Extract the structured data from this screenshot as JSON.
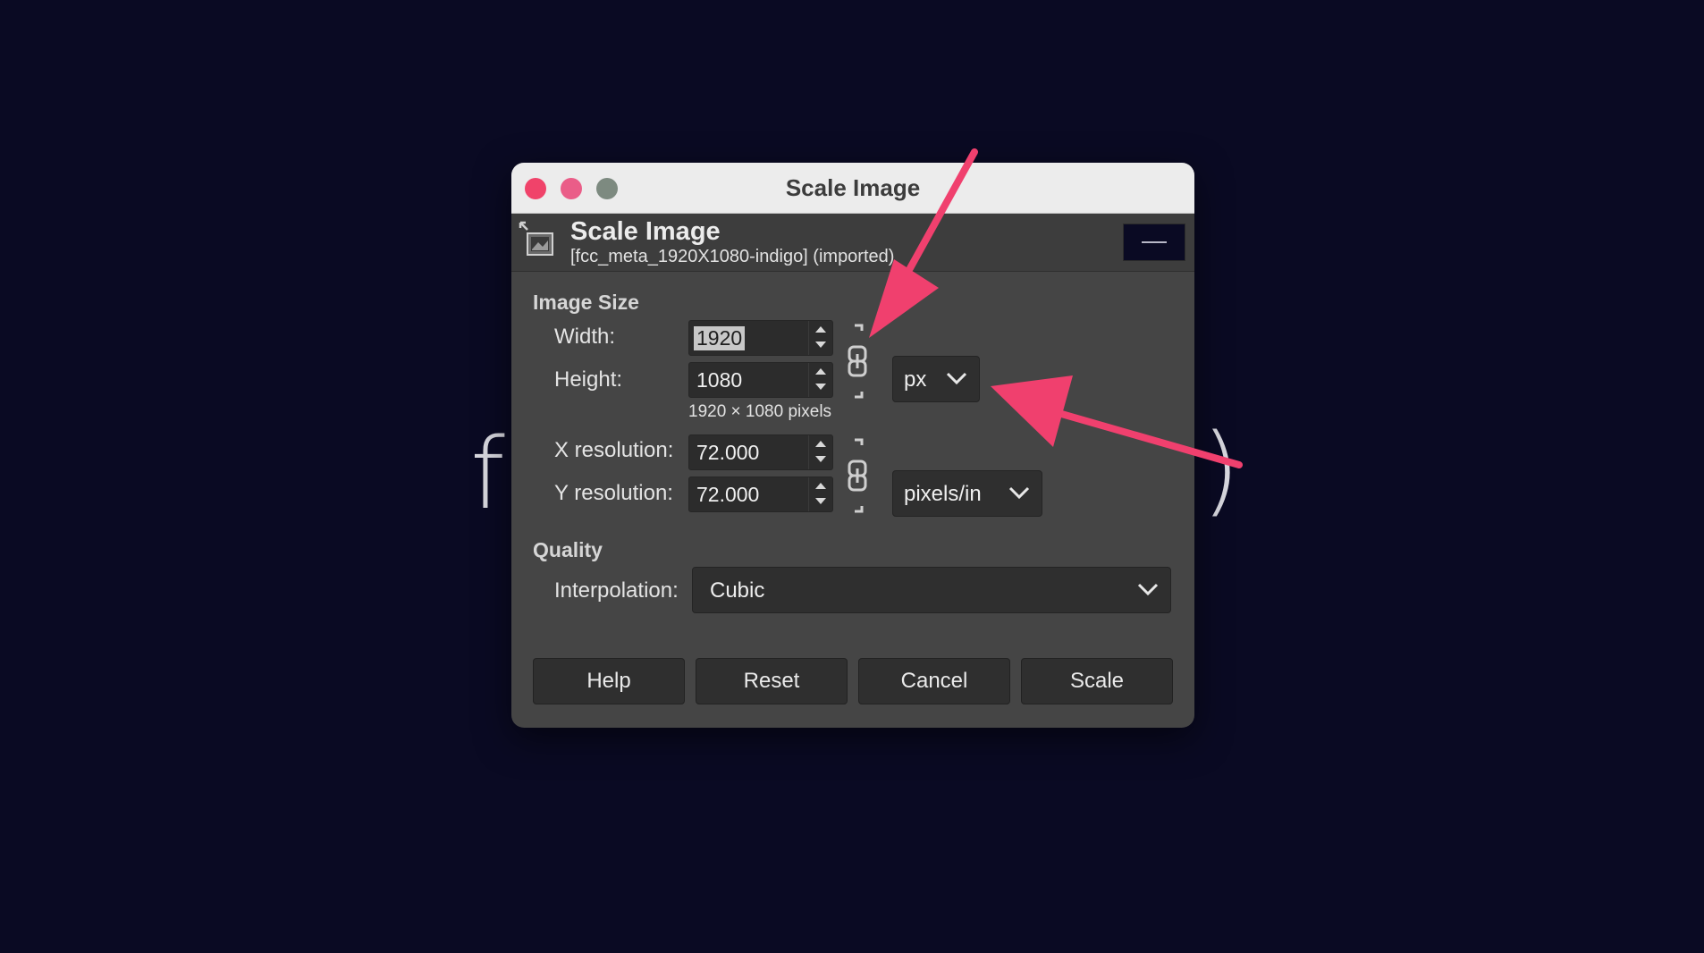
{
  "background": {
    "left_glyph": "f",
    "right_glyph": ")",
    "color": "#0a0a23"
  },
  "window": {
    "title": "Scale Image",
    "traffic_lights": [
      "close",
      "minimize",
      "zoom"
    ]
  },
  "header": {
    "title": "Scale Image",
    "subtitle": "[fcc_meta_1920X1080-indigo] (imported)",
    "icon": "image-scale-icon"
  },
  "image_size": {
    "section_label": "Image Size",
    "width_label": "Width:",
    "width_value": "1920",
    "height_label": "Height:",
    "height_value": "1080",
    "size_hint": "1920 × 1080 pixels",
    "unit": "px",
    "xres_label": "X resolution:",
    "xres_value": "72.000",
    "yres_label": "Y resolution:",
    "yres_value": "72.000",
    "res_unit": "pixels/in"
  },
  "quality": {
    "section_label": "Quality",
    "interpolation_label": "Interpolation:",
    "interpolation_value": "Cubic"
  },
  "buttons": {
    "help": "Help",
    "reset": "Reset",
    "cancel": "Cancel",
    "scale": "Scale"
  },
  "annotation": {
    "arrow_color": "#f0406e"
  }
}
